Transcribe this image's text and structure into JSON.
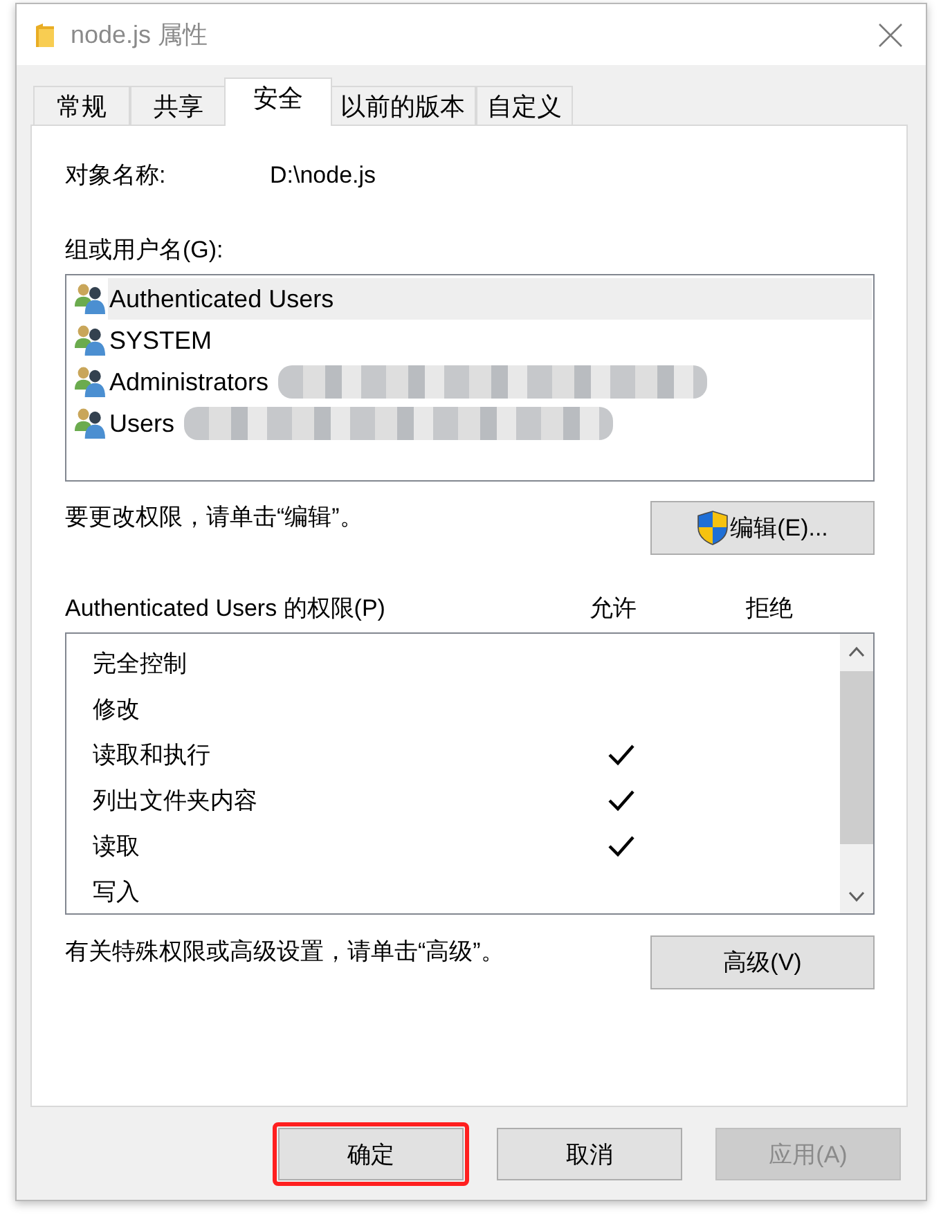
{
  "window": {
    "title": "node.js 属性"
  },
  "tabs": [
    {
      "label": "常规",
      "selected": false
    },
    {
      "label": "共享",
      "selected": false
    },
    {
      "label": "安全",
      "selected": true
    },
    {
      "label": "以前的版本",
      "selected": false
    },
    {
      "label": "自定义",
      "selected": false
    }
  ],
  "object_name": {
    "label": "对象名称:",
    "value": "D:\\node.js"
  },
  "users": {
    "label": "组或用户名(G):",
    "items": [
      {
        "name": "Authenticated Users",
        "selected": true,
        "redacted": false
      },
      {
        "name": "SYSTEM",
        "selected": false,
        "redacted": false
      },
      {
        "name": "Administrators",
        "selected": false,
        "redacted": true
      },
      {
        "name": "Users",
        "selected": false,
        "redacted": true
      }
    ]
  },
  "edit_hint": "要更改权限，请单击“编辑”。",
  "edit_button": "编辑(E)...",
  "permissions": {
    "title": "Authenticated Users 的权限(P)",
    "allow_header": "允许",
    "deny_header": "拒绝",
    "rows": [
      {
        "name": "完全控制",
        "allow": false,
        "deny": false
      },
      {
        "name": "修改",
        "allow": false,
        "deny": false
      },
      {
        "name": "读取和执行",
        "allow": true,
        "deny": false
      },
      {
        "name": "列出文件夹内容",
        "allow": true,
        "deny": false
      },
      {
        "name": "读取",
        "allow": true,
        "deny": false
      },
      {
        "name": "写入",
        "allow": false,
        "deny": false
      }
    ]
  },
  "advanced_hint": "有关特殊权限或高级设置，请单击“高级”。",
  "advanced_button": "高级(V)",
  "dialog_buttons": [
    {
      "label": "确定",
      "highlighted": true,
      "disabled": false
    },
    {
      "label": "取消",
      "highlighted": false,
      "disabled": false
    },
    {
      "label": "应用(A)",
      "highlighted": false,
      "disabled": true
    }
  ]
}
